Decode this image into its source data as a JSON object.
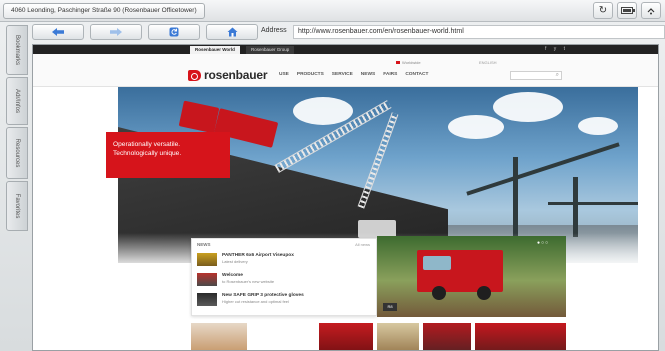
{
  "status_bar": {
    "location": "4060 Leonding, Paschinger Straße 90 (Rosenbauer Officetower)",
    "icons": [
      "refresh-icon",
      "battery-icon",
      "signal-icon"
    ]
  },
  "toolbar": {
    "back_icon": "arrow-left-icon",
    "forward_icon": "arrow-right-icon",
    "reload_icon": "reload-icon",
    "home_icon": "home-icon",
    "address_label": "Address",
    "address_value": "http://www.rosenbauer.com/en/rosenbauer-world.html"
  },
  "sidebar": {
    "tabs": [
      "Bookmarks",
      "Adr/Infos",
      "Resources",
      "Favorites"
    ]
  },
  "website": {
    "top_tabs": [
      "Rosenbauer World",
      "Rosenbauer Group"
    ],
    "social_icons": "f  y  t",
    "logo_text": "rosenbauer",
    "nav_items": [
      "USE",
      "PRODUCTS",
      "SERVICE",
      "NEWS",
      "FAIRS",
      "CONTACT"
    ],
    "region_label": "Worldwide",
    "top_links": "ENGLISH",
    "hero_tagline_1": "Operationally versatile.",
    "hero_tagline_2": "Technologically unique.",
    "news": {
      "heading": "NEWS",
      "all_link": "All news",
      "items": [
        {
          "title": "PANTHER 6x6 Airport Viseupox",
          "subtitle": "Latest delivery"
        },
        {
          "title": "Welcome",
          "subtitle": "to Rosenbauer's new website"
        },
        {
          "title": "New SAFE GRIP 3 protective gloves",
          "subtitle": "Higher cut resistance and optimal feel"
        }
      ]
    },
    "feature_button": "R8"
  },
  "colors": {
    "brand_red": "#d6141b",
    "frame_border": "#9aa0a4",
    "chrome_bg": "#dfe2e4"
  }
}
